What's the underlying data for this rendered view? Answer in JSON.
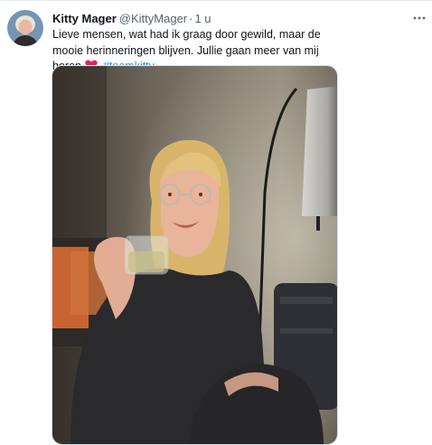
{
  "tweet": {
    "author_name": "Kitty Mager",
    "author_handle": "@KittyMager",
    "separator": "·",
    "time_ago": "1 u",
    "text_main": "Lieve mensen, wat had ik graag door gewild, maar de mooie herinneringen blijven. Jullie gaan meer van mij horen",
    "hashtag": "#teamkitty",
    "heart_color": "#e0245e",
    "hashtag_color": "#1d9bf0"
  },
  "icons": {
    "more": "more-horizontal-icon",
    "heart": "red-heart-emoji-icon"
  }
}
